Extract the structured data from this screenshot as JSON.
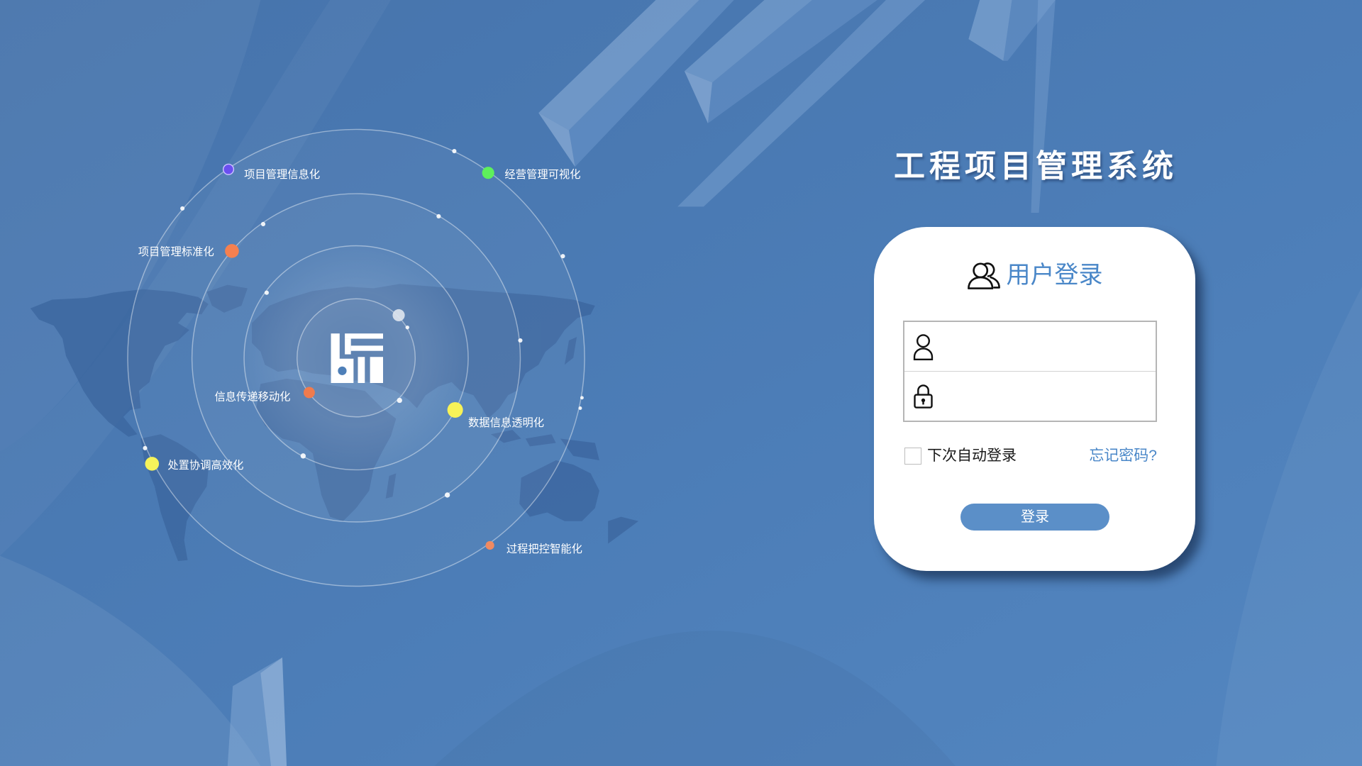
{
  "app": {
    "title": "工程项目管理系统"
  },
  "logo": {
    "icon": "logo-icon"
  },
  "features": [
    {
      "label": "项目管理信息化",
      "dot_color": "#6a4ff0"
    },
    {
      "label": "经营管理可视化",
      "dot_color": "#5ef05c"
    },
    {
      "label": "项目管理标准化",
      "dot_color": "#f5804f"
    },
    {
      "label": "信息传递移动化",
      "dot_color": "#f07b4d"
    },
    {
      "label": "数据信息透明化",
      "dot_color": "#f7f257"
    },
    {
      "label": "处置协调高效化",
      "dot_color": "#f5f35a"
    },
    {
      "label": "过程把控智能化",
      "dot_color": "#f08a62"
    }
  ],
  "login": {
    "heading": "用户登录",
    "heading_icon": "users-icon",
    "username": {
      "icon": "user-icon",
      "value": ""
    },
    "password": {
      "icon": "lock-icon",
      "value": ""
    },
    "remember": {
      "label": "下次自动登录",
      "checked": false
    },
    "forgot_label": "忘记密码?",
    "submit_label": "登录"
  },
  "colors": {
    "background": "#4e7fb8",
    "accent": "#4a87c8",
    "button": "#5b8fc8",
    "card": "#ffffff"
  }
}
